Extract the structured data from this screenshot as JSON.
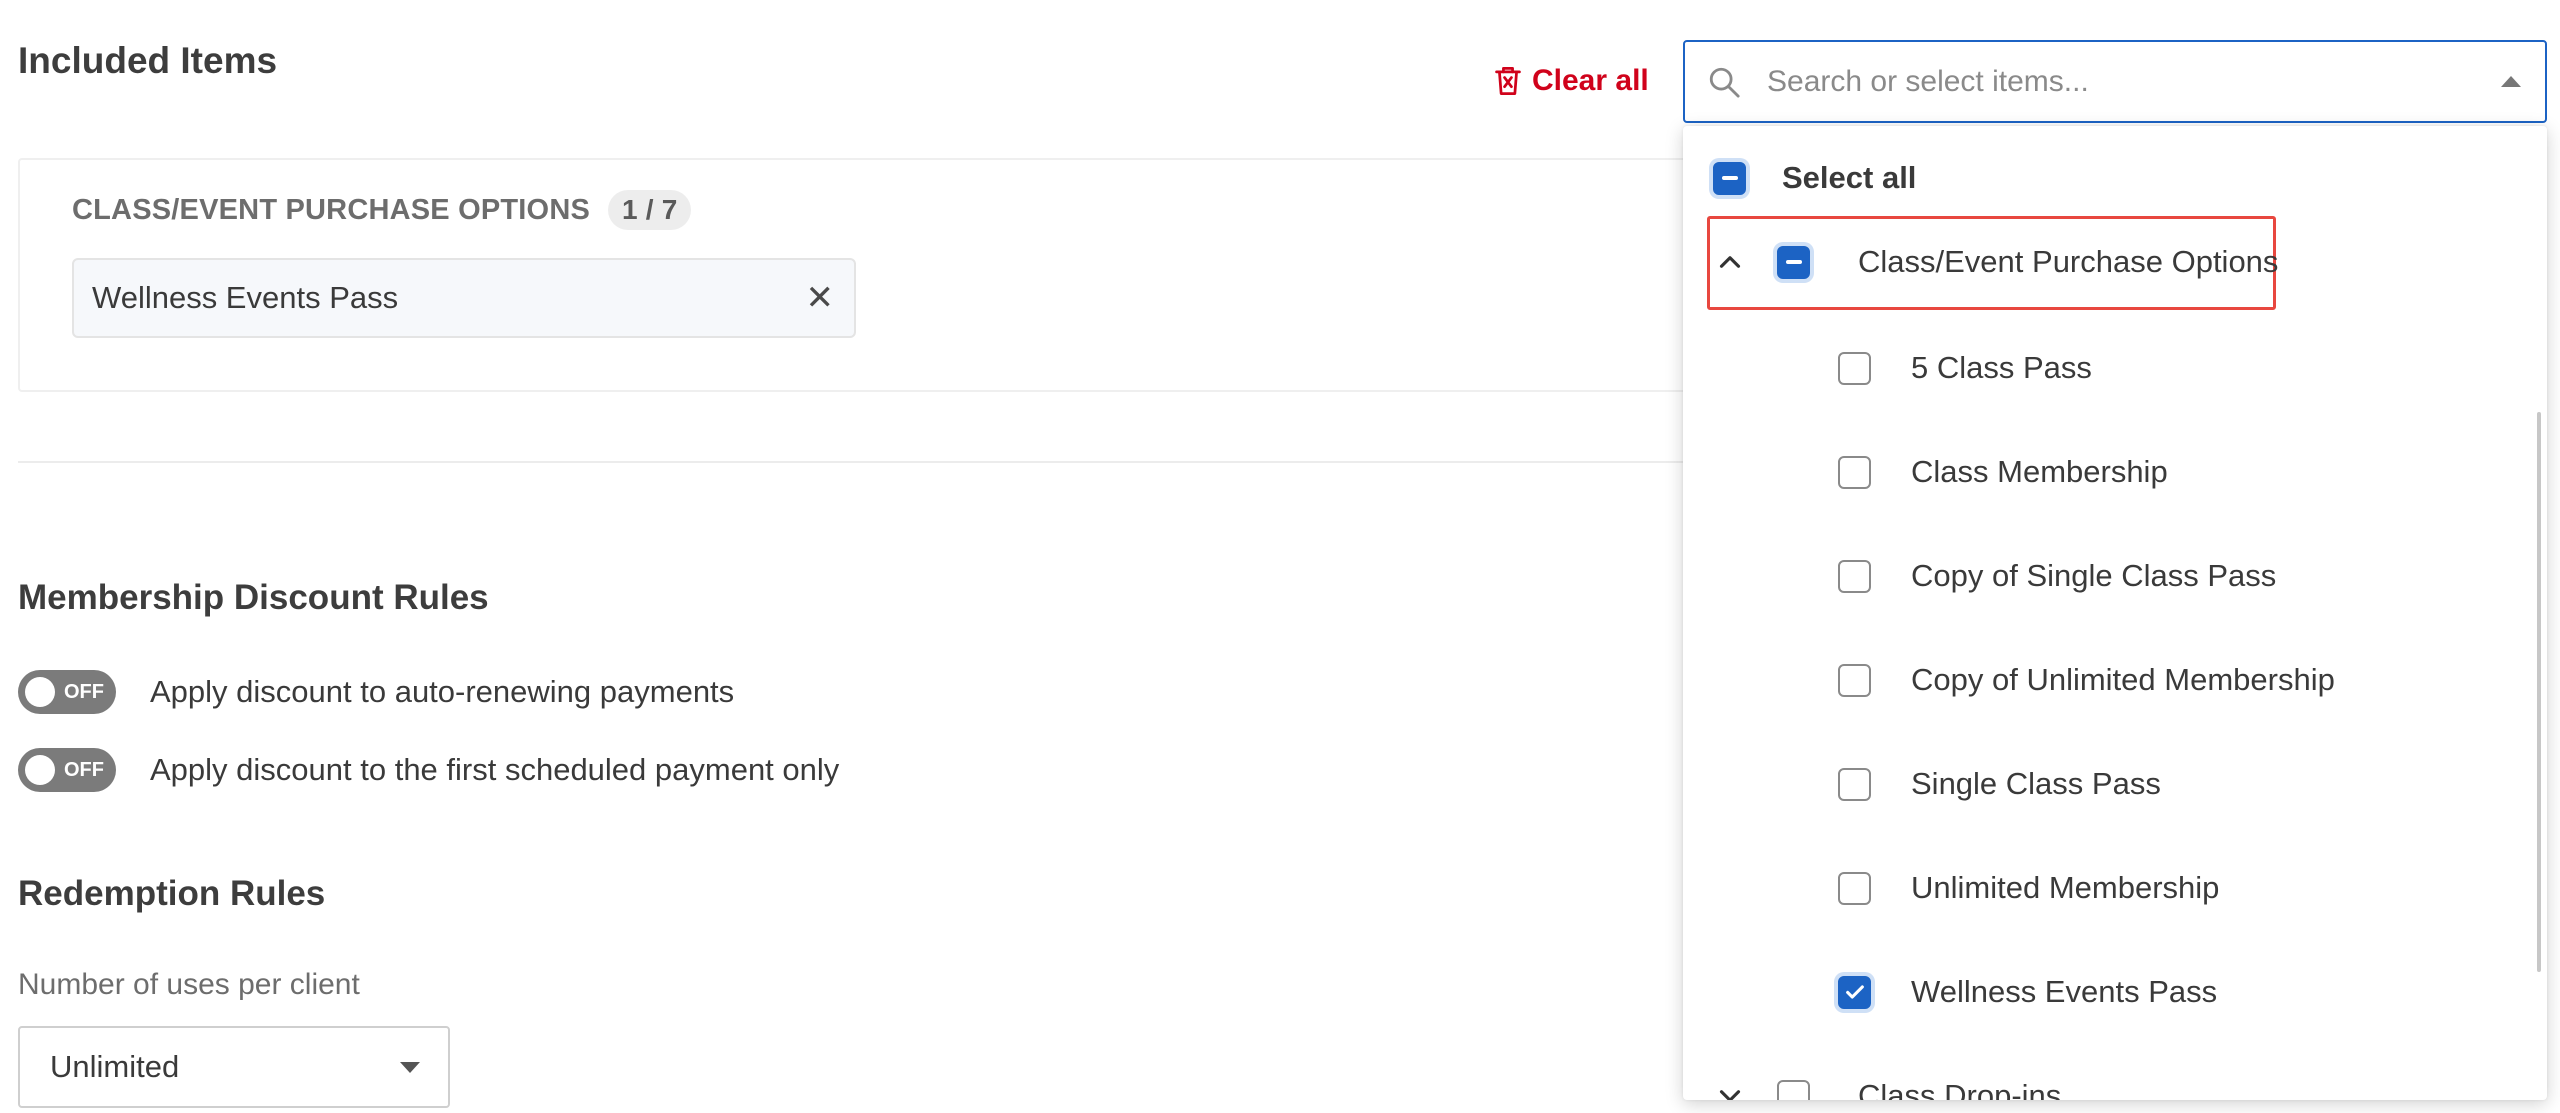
{
  "page": {
    "title": "Included Items",
    "clear_all_label": "Clear all"
  },
  "included": {
    "group_label": "CLASS/EVENT PURCHASE OPTIONS",
    "count": "1 / 7",
    "chips": [
      {
        "label": "Wellness Events Pass"
      }
    ]
  },
  "membership_rules": {
    "title": "Membership Discount Rules",
    "toggles": [
      {
        "state_label": "OFF",
        "label": "Apply discount to auto-renewing payments",
        "on": false
      },
      {
        "state_label": "OFF",
        "label": "Apply discount to the first scheduled payment only",
        "on": false
      }
    ]
  },
  "redemption_rules": {
    "title": "Redemption Rules",
    "uses_label": "Number of uses per client",
    "uses_value": "Unlimited"
  },
  "dropdown": {
    "placeholder": "Search or select items...",
    "select_all_label": "Select all",
    "groups": [
      {
        "label": "Class/Event Purchase Options",
        "expanded": true,
        "state": "partial",
        "items": [
          {
            "label": "5 Class Pass",
            "checked": false
          },
          {
            "label": "Class Membership",
            "checked": false
          },
          {
            "label": "Copy of Single Class Pass",
            "checked": false
          },
          {
            "label": "Copy of Unlimited Membership",
            "checked": false
          },
          {
            "label": "Single Class Pass",
            "checked": false
          },
          {
            "label": "Unlimited Membership",
            "checked": false
          },
          {
            "label": "Wellness Events Pass",
            "checked": true
          }
        ]
      },
      {
        "label": "Class Drop-ins",
        "expanded": false,
        "state": "unchecked",
        "items": []
      }
    ]
  },
  "colors": {
    "accent": "#1c63c4",
    "danger": "#d0021b",
    "highlight": "#e8473f",
    "toggle_off": "#7b7b7b"
  }
}
